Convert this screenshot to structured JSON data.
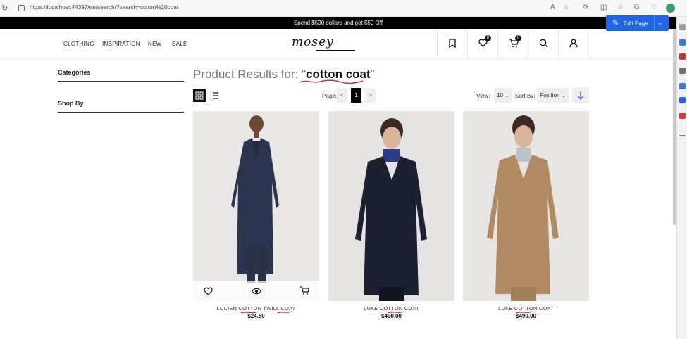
{
  "browser": {
    "url": "https://localhost:44397/en/search/?search=cotton%20coat"
  },
  "promo": {
    "text": "Spend $500 dollars and get $50 Off"
  },
  "edit_page": {
    "label": "Edit Page"
  },
  "nav": {
    "items": [
      "CLOTHING",
      "INSPIRATION",
      "NEW",
      "SALE"
    ],
    "logo": "mosey"
  },
  "header": {
    "wishlist_count": "0",
    "cart_count": "0"
  },
  "sidebar": {
    "categories_label": "Categories",
    "shopby_label": "Shop By"
  },
  "results": {
    "prefix": "Product Results for: \"",
    "query": "cotton coat",
    "suffix": "\""
  },
  "toolbar": {
    "page_label": "Page:",
    "prev": "<",
    "current_page": "1",
    "next": ">",
    "view_label": "View:",
    "view_value": "10",
    "sort_label": "Sort By:",
    "sort_value": "Position"
  },
  "products": [
    {
      "name": "LUCIEN COTTON TWILL COAT",
      "price": "$24.50",
      "coat_color": "#2c3550",
      "inner_color": "#23283a",
      "bg": "#e8e7e5"
    },
    {
      "name": "LUKE COTTON COAT",
      "price": "$490.00",
      "coat_color": "#1b2033",
      "inner_color": "#2a3e8a",
      "bg": "#e5e4e2"
    },
    {
      "name": "LUKE COTTON COAT",
      "price": "$490.00",
      "coat_color": "#b08a62",
      "inner_color": "#b9c2c9",
      "bg": "#e6e5e3"
    }
  ],
  "colors": {
    "accent_blue": "#1f66e5",
    "annotation_red": "#d11d1d"
  }
}
